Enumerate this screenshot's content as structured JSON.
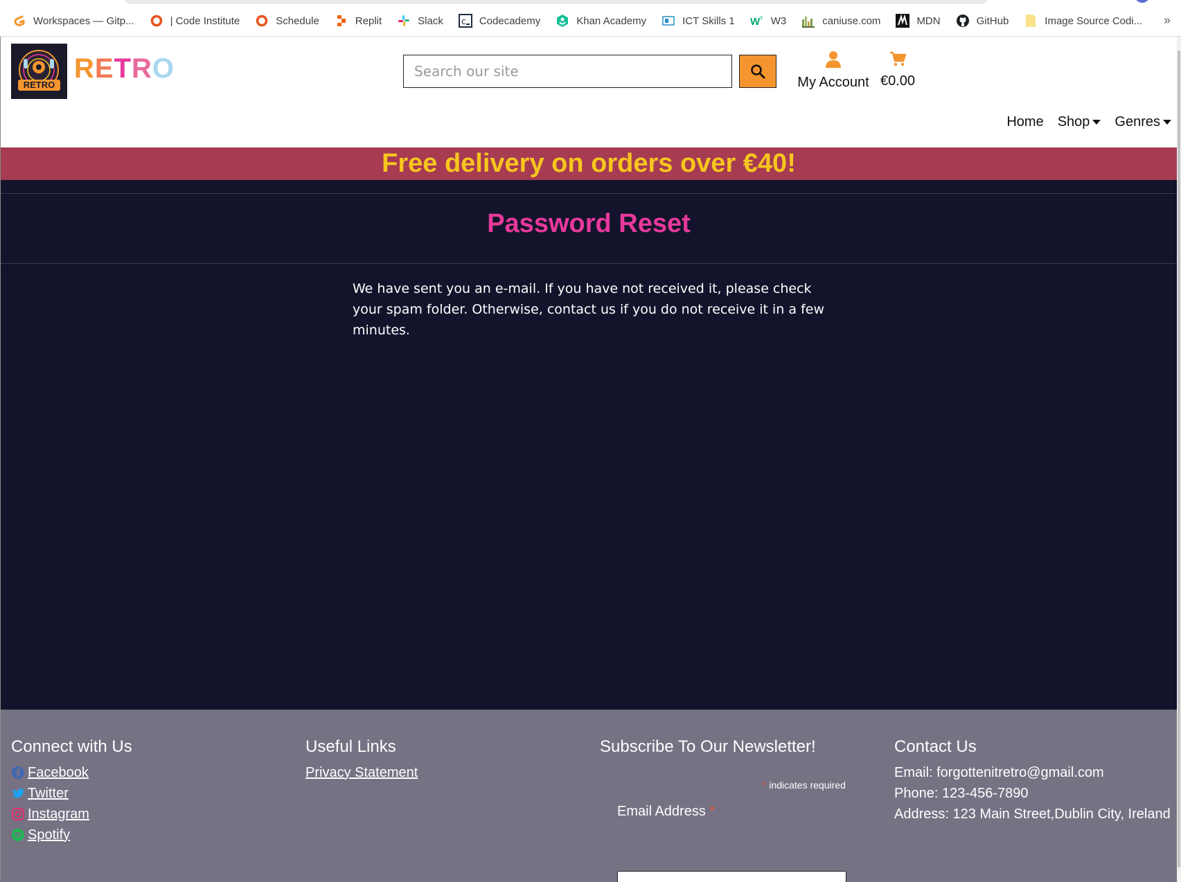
{
  "bookmarks": [
    {
      "label": "Workspaces — Gitp...",
      "icon": "gitpod-icon"
    },
    {
      "label": "| Code Institute",
      "icon": "code-institute-icon"
    },
    {
      "label": "Schedule",
      "icon": "schedule-icon"
    },
    {
      "label": "Replit",
      "icon": "replit-icon"
    },
    {
      "label": "Slack",
      "icon": "slack-icon"
    },
    {
      "label": "Codecademy",
      "icon": "codecademy-icon"
    },
    {
      "label": "Khan Academy",
      "icon": "khan-academy-icon"
    },
    {
      "label": "ICT Skills 1",
      "icon": "ict-skills-icon"
    },
    {
      "label": "W3",
      "icon": "w3-icon"
    },
    {
      "label": "caniuse.com",
      "icon": "caniuse-icon"
    },
    {
      "label": "MDN",
      "icon": "mdn-icon"
    },
    {
      "label": "GitHub",
      "icon": "github-icon"
    },
    {
      "label": "Image Source Codi...",
      "icon": "folder-icon"
    }
  ],
  "bookmarks_overflow": "»",
  "header": {
    "logo_text": "RETRO",
    "brand": "RETRO",
    "search_placeholder": "Search our site",
    "account_label": "My Account",
    "cart_total": "€0.00",
    "colors": {
      "accent": "#f5952f",
      "brand_gradient": [
        "#f5952f",
        "#e8399c",
        "#a9d8ef"
      ]
    }
  },
  "nav": {
    "home": "Home",
    "shop": "Shop",
    "genres": "Genres"
  },
  "banner": {
    "text": "Free delivery on orders over €40!"
  },
  "main": {
    "title": "Password Reset",
    "message": "We have sent you an e-mail. If you have not received it, please check your spam folder. Otherwise, contact us if you do not receive it in a few minutes."
  },
  "footer": {
    "connect": {
      "heading": "Connect with Us",
      "links": [
        {
          "label": " Facebook",
          "icon": "facebook-icon"
        },
        {
          "label": " Twitter",
          "icon": "twitter-icon"
        },
        {
          "label": " Instagram",
          "icon": "instagram-icon"
        },
        {
          "label": " Spotify",
          "icon": "spotify-icon"
        }
      ]
    },
    "useful": {
      "heading": "Useful Links",
      "privacy": "Privacy Statement"
    },
    "newsletter": {
      "heading": "Subscribe To Our Newsletter!",
      "required_star": "*",
      "required_note": " indicates required",
      "email_label": "Email Address ",
      "email_star": "*"
    },
    "contact": {
      "heading": "Contact Us",
      "email": "Email: forgottenitretro@gmail.com",
      "phone": "Phone: 123-456-7890",
      "address": "Address: 123 Main Street,Dublin City, Ireland"
    }
  }
}
